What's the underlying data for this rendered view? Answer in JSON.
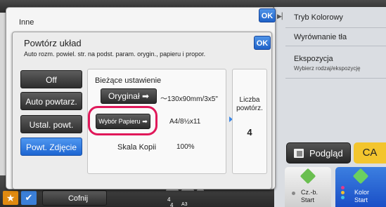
{
  "outer_dialog": {
    "title": "Inne",
    "ok_label": "OK"
  },
  "inner_dialog": {
    "title": "Powtórz układ",
    "description": "Auto rozm. powiel. str. na podst. param. orygin., papieru i propor.",
    "ok_label": "OK",
    "options": [
      {
        "label": "Off",
        "selected": false
      },
      {
        "label": "Auto powtarz.",
        "selected": false
      },
      {
        "label": "Ustal. powt.",
        "selected": false
      },
      {
        "label": "Powt. Zdjęcie",
        "selected": true
      }
    ],
    "current_settings": {
      "title": "Bieżące ustawienie",
      "original_button": "Oryginał",
      "original_value": "～130x90mm/3x5\"",
      "paper_button": "Wybór Papieru",
      "paper_value": "A4/8½x11",
      "scale_label": "Skala Kopii",
      "scale_value": "100%"
    },
    "repeat_count": {
      "label_line1": "Liczba",
      "label_line2": "powtórz.",
      "value": "4"
    }
  },
  "right_panel": {
    "items": [
      {
        "label": "Tryb Kolorowy"
      },
      {
        "label": "Wyrównanie tła"
      },
      {
        "label": "Ekspozycja",
        "sub": "Wybierz rodzaj/ekspozycję"
      }
    ],
    "preview_label": "Podgląd",
    "ca_label": "CA",
    "start_bw_line1": "Cz.-b.",
    "start_bw_line2": "Start",
    "start_color_line1": "Kolor",
    "start_color_line2": "Start"
  },
  "bottom_bar": {
    "back_label": "Cofnij",
    "thumb_num_1": "4",
    "thumb_num_2": "4",
    "thumb_size": "A3"
  },
  "colors": {
    "accent_blue": "#1e66d2",
    "highlight": "#e0185a",
    "ca_yellow": "#f3c52e",
    "star_orange": "#e08a10"
  }
}
